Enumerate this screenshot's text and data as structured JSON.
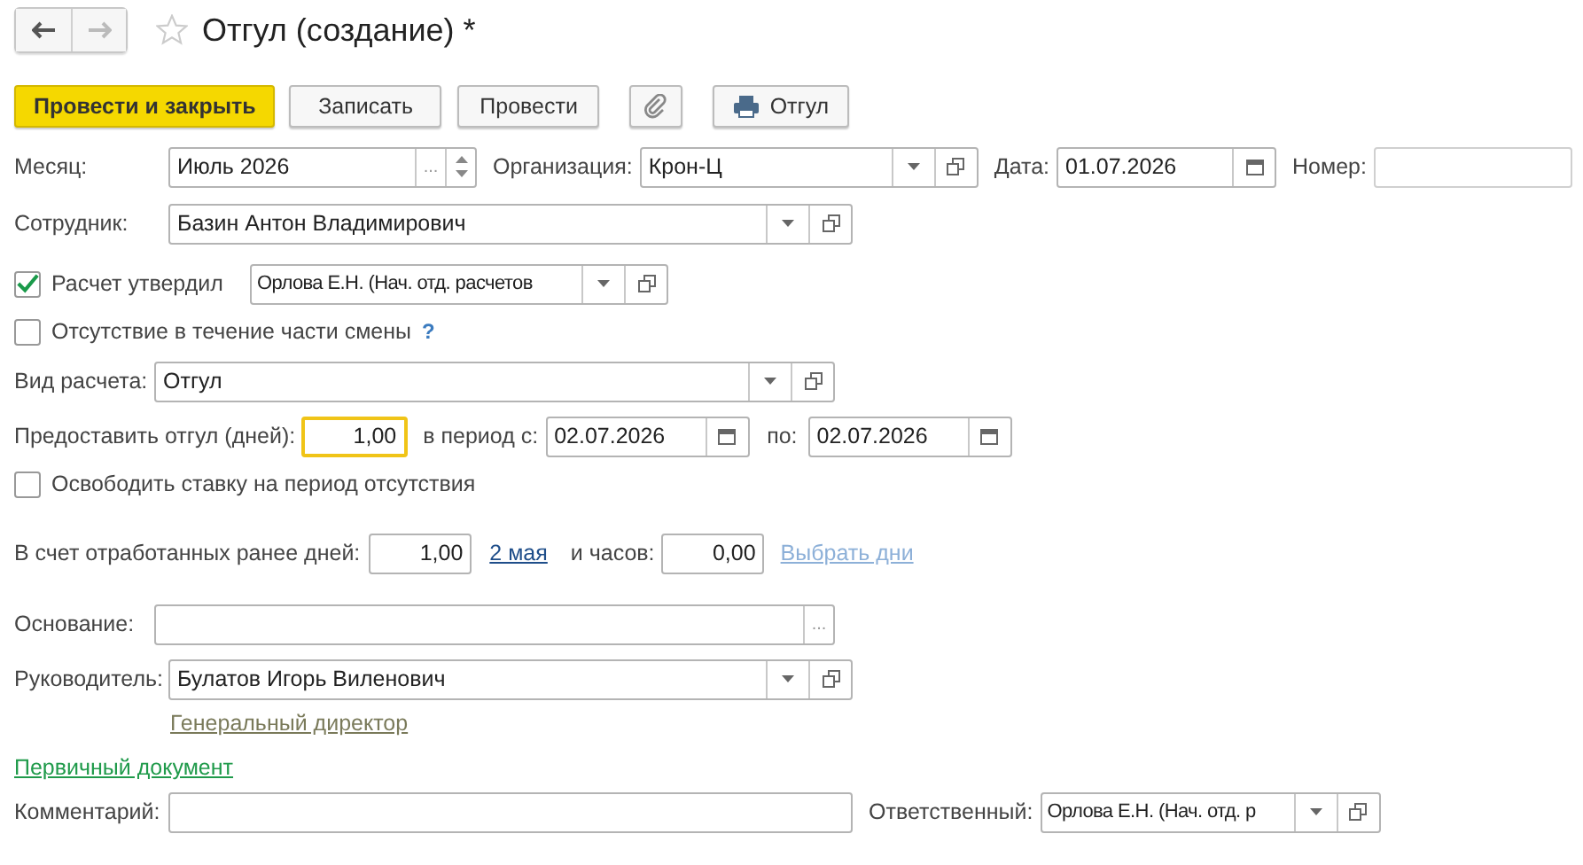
{
  "nav": [
    {
      "kind": "back",
      "disabled": false
    },
    {
      "kind": "forward",
      "disabled": true
    }
  ],
  "favorite": false,
  "title": "Отгул (создание) *",
  "toolbar": [
    {
      "kind": "primary",
      "label": "Провести и закрыть"
    },
    {
      "kind": "plain",
      "label": "Записать"
    },
    {
      "kind": "plain",
      "label": "Провести"
    },
    {
      "kind": "attach"
    },
    {
      "kind": "print",
      "label": "Отгул"
    }
  ],
  "month": {
    "label": "Месяц:",
    "value": "Июль 2026",
    "select_button": "..."
  },
  "organization": {
    "label": "Организация:",
    "value": "Крон-Ц"
  },
  "date": {
    "label": "Дата:",
    "value": "01.07.2026"
  },
  "number": {
    "label": "Номер:"
  },
  "employee": {
    "label": "Сотрудник:",
    "value": "Базин Антон Владимирович"
  },
  "approved": {
    "label": "Расчет утвердил",
    "checked": true,
    "value": "Орлова Е.Н. (Нач. отд. расчетов"
  },
  "partial_shift": {
    "label": "Отсутствие в течение части смены",
    "checked": false,
    "help": "?"
  },
  "calc_type": {
    "label": "Вид расчета:",
    "value": "Отгул"
  },
  "grant": {
    "label": "Предоставить отгул (дней):",
    "value": "1,00",
    "focused": true
  },
  "period_from": {
    "label": "в период с:",
    "value": "02.07.2026"
  },
  "period_to": {
    "label": "по:",
    "value": "02.07.2026"
  },
  "release_rate": {
    "label": "Освободить ставку на период отсутствия",
    "checked": false
  },
  "worked_days": {
    "label": "В счет отработанных ранее дней:",
    "value": "1,00",
    "link": "2 мая"
  },
  "hours": {
    "label": "и часов:",
    "value": "0,00",
    "link": "Выбрать дни"
  },
  "basis": {
    "label": "Основание:",
    "select_button": "..."
  },
  "manager": {
    "label": "Руководитель:",
    "value": "Булатов Игорь Виленович",
    "position_link": "Генеральный директор"
  },
  "primary_doc_link": "Первичный документ",
  "comment": {
    "label": "Комментарий:"
  },
  "responsible": {
    "label": "Ответственный:",
    "value": "Орлова Е.Н. (Нач. отд. р"
  }
}
